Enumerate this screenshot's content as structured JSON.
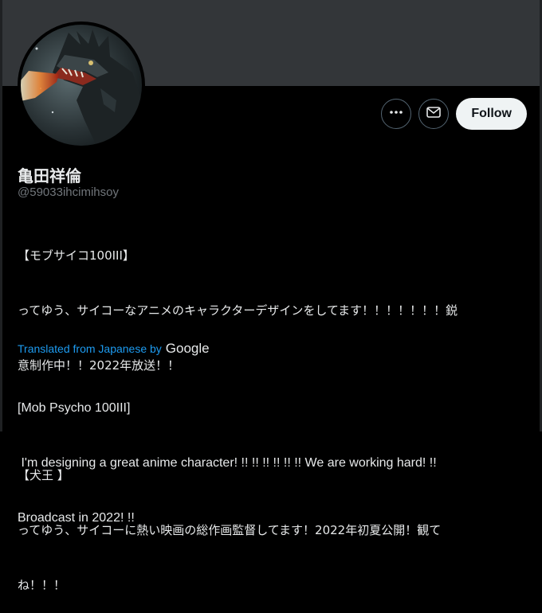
{
  "profile": {
    "display_name": "亀田祥倫",
    "handle": "@59033ihcimihsoy"
  },
  "actions": {
    "more_icon": "ellipsis-icon",
    "message_icon": "mail-icon",
    "follow_label": "Follow"
  },
  "bio": {
    "line1": "【モブサイコ100III】",
    "line2": "ってゆう、サイコーなアニメのキャラクターデザインをしてます！！！！！！！鋭",
    "line3": "意制作中！！2022年放送！！",
    "line4": "【犬王 】",
    "line5": "ってゆう、サイコーに熱い映画の総作画監督してます！2022年初夏公開！観て",
    "line6": "ね！！！"
  },
  "translation": {
    "label": "Translated from Japanese by",
    "provider": "Google",
    "line1": "[Mob Psycho 100III]",
    "line2": " I'm designing a great anime character! !! !! !! !! !! !! We are working hard! !!",
    "line3": "Broadcast in 2022! !!"
  },
  "colors": {
    "banner": "#333639",
    "link_blue": "#1d9bf0",
    "handle_gray": "#71767b"
  }
}
